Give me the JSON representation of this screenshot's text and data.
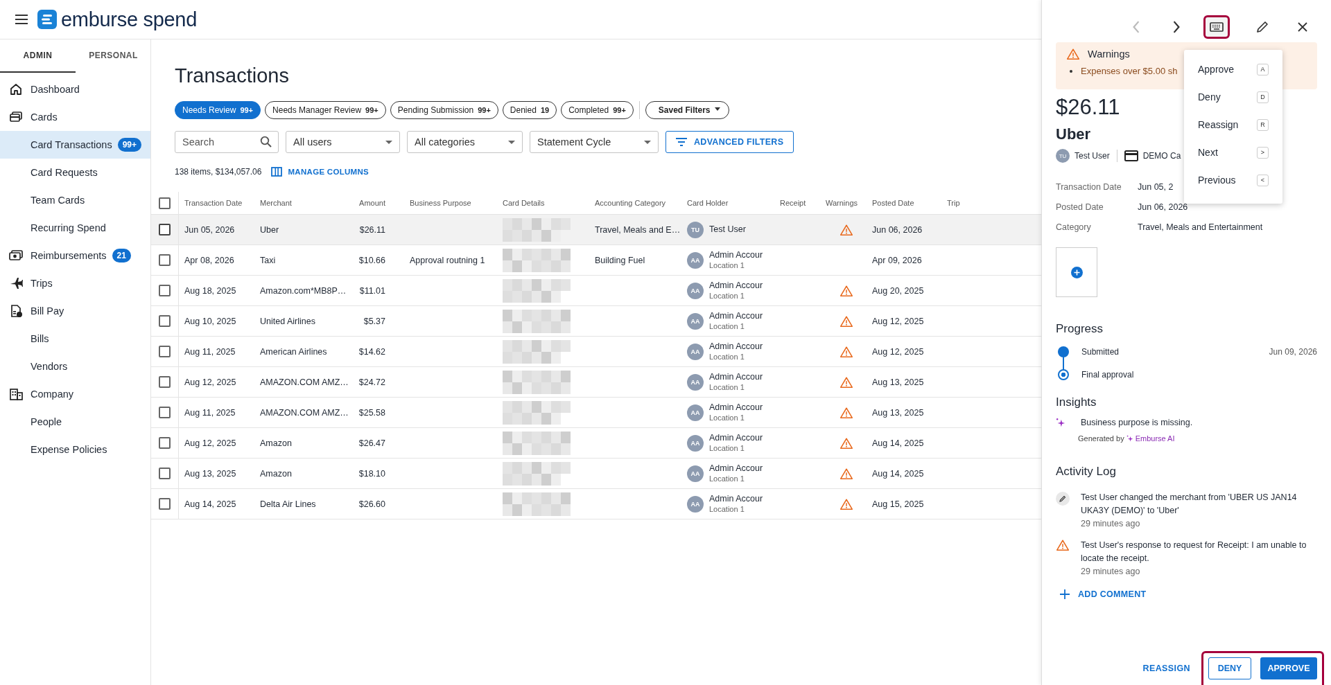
{
  "header": {
    "brand": "emburse spend"
  },
  "sidebar": {
    "tabs": [
      {
        "label": "ADMIN",
        "selected": true
      },
      {
        "label": "PERSONAL",
        "selected": false
      }
    ],
    "items": [
      {
        "label": "Dashboard",
        "selected": false
      },
      {
        "label": "Cards",
        "selected": false,
        "children": [
          {
            "label": "Card Transactions",
            "badge": "99+",
            "selected": true
          },
          {
            "label": "Card Requests",
            "selected": false
          },
          {
            "label": "Team Cards",
            "selected": false
          },
          {
            "label": "Recurring Spend",
            "selected": false
          }
        ]
      },
      {
        "label": "Reimbursements",
        "badge": "21",
        "selected": false
      },
      {
        "label": "Trips",
        "selected": false
      },
      {
        "label": "Bill Pay",
        "selected": false,
        "children": [
          {
            "label": "Bills",
            "selected": false
          },
          {
            "label": "Vendors",
            "selected": false
          }
        ]
      },
      {
        "label": "Company",
        "selected": false,
        "children": [
          {
            "label": "People",
            "selected": false
          },
          {
            "label": "Expense Policies",
            "selected": false
          }
        ]
      }
    ]
  },
  "main": {
    "title": "Transactions",
    "chips": [
      {
        "label": "Needs Review",
        "count": "99+",
        "selected": true
      },
      {
        "label": "Needs Manager Review",
        "count": "99+",
        "selected": false
      },
      {
        "label": "Pending Submission",
        "count": "99+",
        "selected": false
      },
      {
        "label": "Denied",
        "count": "19",
        "selected": false
      },
      {
        "label": "Completed",
        "count": "99+",
        "selected": false
      }
    ],
    "saved_filters": "Saved Filters",
    "search": {
      "placeholder": "Search"
    },
    "selects": [
      "All users",
      "All categories",
      "Statement Cycle"
    ],
    "advanced_filters": "ADVANCED FILTERS",
    "summary": "138 items, $134,057.06",
    "manage_columns": "MANAGE COLUMNS",
    "table": {
      "all_checked": false,
      "columns": [
        "Transaction Date",
        "Merchant",
        "Amount",
        "Business Purpose",
        "Card Details",
        "Accounting Category",
        "Card Holder",
        "Receipt",
        "Warnings",
        "Posted Date",
        "Trip"
      ],
      "rows": [
        {
          "date": "Jun 05, 2026",
          "merchant": "Uber",
          "amount": "$26.11",
          "category": "Travel, Meals and E…",
          "initials": "TU",
          "holder": "Test User",
          "warning": true,
          "posted": "Jun 06, 2026",
          "selected": true
        },
        {
          "date": "Apr 08, 2026",
          "merchant": "Taxi",
          "amount": "$10.66",
          "purpose": "Approval routning 1",
          "category": "Building Fuel",
          "initials": "AA",
          "holder": "Admin Accour",
          "location": "Location 1",
          "warning": false,
          "posted": "Apr 09, 2026",
          "selected": false
        },
        {
          "date": "Aug 18, 2025",
          "merchant": "Amazon.com*MB8P…",
          "amount": "$11.01",
          "initials": "AA",
          "holder": "Admin Accour",
          "location": "Location 1",
          "warning": true,
          "posted": "Aug 20, 2025",
          "selected": false
        },
        {
          "date": "Aug 10, 2025",
          "merchant": "United Airlines",
          "amount": "$5.37",
          "initials": "AA",
          "holder": "Admin Accour",
          "location": "Location 1",
          "warning": true,
          "posted": "Aug 12, 2025",
          "selected": false
        },
        {
          "date": "Aug 11, 2025",
          "merchant": "American Airlines",
          "amount": "$14.62",
          "initials": "AA",
          "holder": "Admin Accour",
          "location": "Location 1",
          "warning": true,
          "posted": "Aug 12, 2025",
          "selected": false
        },
        {
          "date": "Aug 12, 2025",
          "merchant": "AMAZON.COM AMZ…",
          "amount": "$24.72",
          "initials": "AA",
          "holder": "Admin Accour",
          "location": "Location 1",
          "warning": true,
          "posted": "Aug 13, 2025",
          "selected": false
        },
        {
          "date": "Aug 11, 2025",
          "merchant": "AMAZON.COM AMZ…",
          "amount": "$25.58",
          "initials": "AA",
          "holder": "Admin Accour",
          "location": "Location 1",
          "warning": true,
          "posted": "Aug 13, 2025",
          "selected": false
        },
        {
          "date": "Aug 12, 2025",
          "merchant": "Amazon",
          "amount": "$26.47",
          "initials": "AA",
          "holder": "Admin Accour",
          "location": "Location 1",
          "warning": true,
          "posted": "Aug 14, 2025",
          "selected": false
        },
        {
          "date": "Aug 13, 2025",
          "merchant": "Amazon",
          "amount": "$18.10",
          "initials": "AA",
          "holder": "Admin Accour",
          "location": "Location 1",
          "warning": true,
          "posted": "Aug 14, 2025",
          "selected": false
        },
        {
          "date": "Aug 14, 2025",
          "merchant": "Delta Air Lines",
          "amount": "$26.60",
          "initials": "AA",
          "holder": "Admin Accour",
          "location": "Location 1",
          "warning": true,
          "posted": "Aug 15, 2025",
          "selected": false
        }
      ]
    }
  },
  "panel": {
    "toolbar": [
      {
        "kind": "previous",
        "disabled": true,
        "highlighted": false
      },
      {
        "kind": "next",
        "disabled": false,
        "highlighted": false
      },
      {
        "kind": "keyboard",
        "disabled": false,
        "highlighted": true
      },
      {
        "kind": "edit",
        "disabled": false,
        "highlighted": false
      },
      {
        "kind": "close",
        "disabled": false,
        "highlighted": false
      }
    ],
    "warnings": {
      "title": "Warnings",
      "items": [
        "Expenses over $5.00 sh"
      ]
    },
    "amount": "$26.11",
    "merchant": "Uber",
    "user_initials": "TU",
    "user": "Test User",
    "card": "DEMO Ca",
    "details": [
      {
        "label": "Transaction Date",
        "value": "Jun 05, 2"
      },
      {
        "label": "Posted Date",
        "value": "Jun 06, 2026"
      },
      {
        "label": "Category",
        "value": "Travel, Meals and Entertainment"
      }
    ],
    "progress": {
      "title": "Progress",
      "steps": [
        {
          "label": "Submitted",
          "date": "Jun 09, 2026",
          "done": true
        },
        {
          "label": "Final approval",
          "done": false
        }
      ]
    },
    "insights": {
      "title": "Insights",
      "text": "Business purpose is missing.",
      "generated_by": "Generated by",
      "source": "Emburse AI"
    },
    "activity": {
      "title": "Activity Log",
      "entries": [
        {
          "kind": "edit",
          "text": "Test User changed the merchant from 'UBER US JAN14 UKA3Y (DEMO)' to 'Uber'",
          "time": "29 minutes ago"
        },
        {
          "kind": "warning",
          "text": "Test User's response to request for Receipt: I am unable to locate the receipt.",
          "time": "29 minutes ago"
        }
      ],
      "add_comment": "ADD COMMENT"
    },
    "footer": {
      "reassign": "REASSIGN",
      "deny": "DENY",
      "approve": "APPROVE",
      "highlighted": true
    },
    "shortcut_menu": {
      "items": [
        {
          "label": "Approve",
          "key": "A"
        },
        {
          "label": "Deny",
          "key": "D"
        },
        {
          "label": "Reassign",
          "key": "R"
        },
        {
          "label": "Next",
          "key": ">"
        },
        {
          "label": "Previous",
          "key": "<"
        }
      ]
    }
  }
}
